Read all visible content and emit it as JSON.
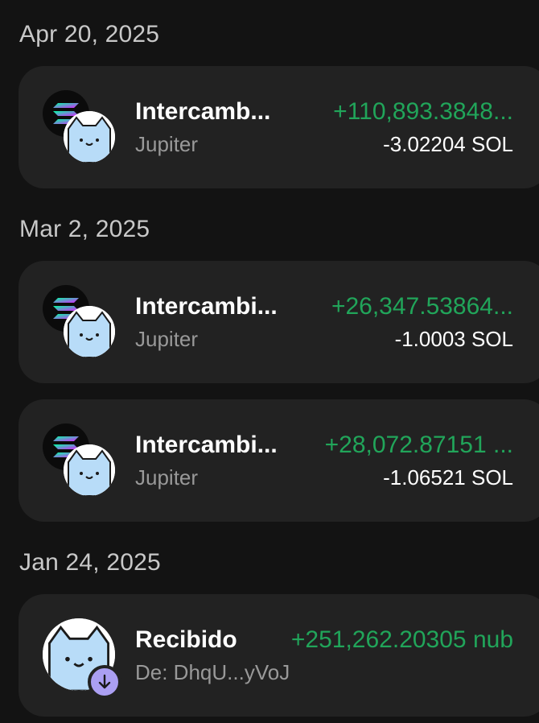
{
  "colors": {
    "background": "#131313",
    "card": "#222222",
    "positive": "#21a55a",
    "muted": "#999999",
    "badge": "#ab9ff2"
  },
  "groups": [
    {
      "date": "Apr 20, 2025",
      "items": [
        {
          "title": "Intercamb...",
          "subtitle": "Jupiter",
          "amount": "+110,893.3848...",
          "sol": "-3.02204 SOL",
          "icon": "solana-jupiter-swap-icon"
        }
      ]
    },
    {
      "date": "Mar 2, 2025",
      "items": [
        {
          "title": "Intercambi...",
          "subtitle": "Jupiter",
          "amount": "+26,347.53864...",
          "sol": "-1.0003 SOL",
          "icon": "solana-jupiter-swap-icon"
        },
        {
          "title": "Intercambi...",
          "subtitle": "Jupiter",
          "amount": "+28,072.87151 ...",
          "sol": "-1.06521 SOL",
          "icon": "solana-jupiter-swap-icon"
        }
      ]
    },
    {
      "date": "Jan 24, 2025",
      "items": [
        {
          "title": "Recibido",
          "subtitle": "De: DhqU...yVoJ",
          "amount": "+251,262.20305 nub",
          "icon": "received-arrow-icon"
        }
      ]
    }
  ]
}
